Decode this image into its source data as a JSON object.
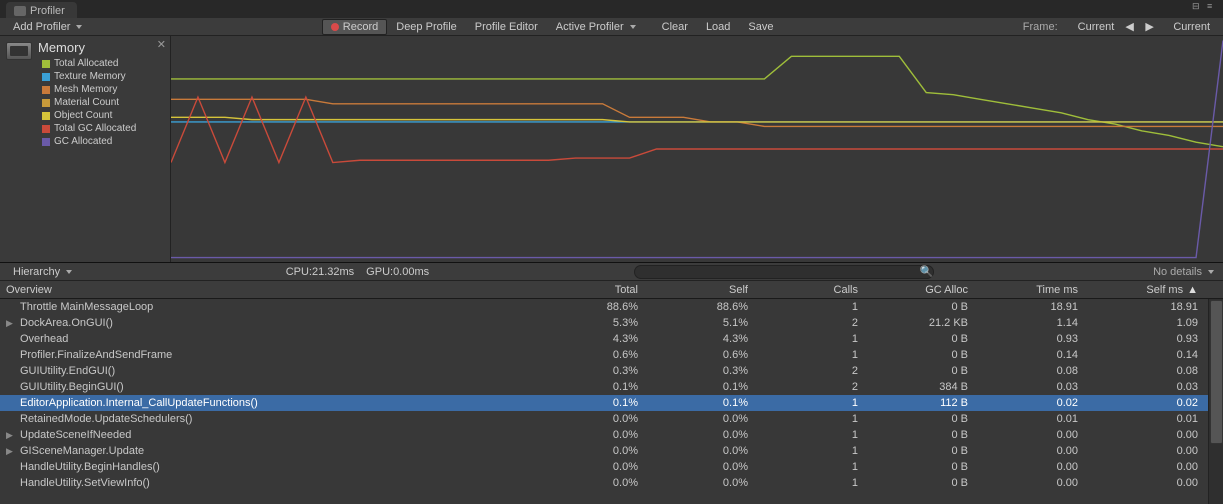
{
  "tab": {
    "title": "Profiler"
  },
  "toolbar": {
    "add_profiler": "Add Profiler",
    "record": "Record",
    "deep_profile": "Deep Profile",
    "profile_editor": "Profile Editor",
    "active_profiler": "Active Profiler",
    "clear": "Clear",
    "load": "Load",
    "save": "Save",
    "frame_label": "Frame:",
    "frame_value": "Current",
    "current_btn": "Current"
  },
  "legend": {
    "title": "Memory",
    "items": [
      {
        "label": "Total Allocated",
        "color": "#9fbe3a"
      },
      {
        "label": "Texture Memory",
        "color": "#3aa0d6"
      },
      {
        "label": "Mesh Memory",
        "color": "#c97a3a"
      },
      {
        "label": "Material Count",
        "color": "#c79a3a"
      },
      {
        "label": "Object Count",
        "color": "#d6c43a"
      },
      {
        "label": "Total GC Allocated",
        "color": "#c94a3a"
      },
      {
        "label": "GC Allocated",
        "color": "#6a5aa8"
      }
    ]
  },
  "stats": {
    "cpu": "CPU:21.32ms",
    "gpu": "GPU:0.00ms"
  },
  "lower": {
    "hierarchy": "Hierarchy",
    "no_details": "No details"
  },
  "columns": {
    "overview": "Overview",
    "total": "Total",
    "self": "Self",
    "calls": "Calls",
    "gc": "GC Alloc",
    "time": "Time ms",
    "selfms": "Self ms"
  },
  "rows": [
    {
      "name": "Throttle MainMessageLoop",
      "total": "88.6%",
      "self": "88.6%",
      "calls": "1",
      "gc": "0 B",
      "time": "18.91",
      "selfms": "18.91",
      "expandable": false
    },
    {
      "name": "DockArea.OnGUI()",
      "total": "5.3%",
      "self": "5.1%",
      "calls": "2",
      "gc": "21.2 KB",
      "time": "1.14",
      "selfms": "1.09",
      "expandable": true
    },
    {
      "name": "Overhead",
      "total": "4.3%",
      "self": "4.3%",
      "calls": "1",
      "gc": "0 B",
      "time": "0.93",
      "selfms": "0.93",
      "expandable": false
    },
    {
      "name": "Profiler.FinalizeAndSendFrame",
      "total": "0.6%",
      "self": "0.6%",
      "calls": "1",
      "gc": "0 B",
      "time": "0.14",
      "selfms": "0.14",
      "expandable": false
    },
    {
      "name": "GUIUtility.EndGUI()",
      "total": "0.3%",
      "self": "0.3%",
      "calls": "2",
      "gc": "0 B",
      "time": "0.08",
      "selfms": "0.08",
      "expandable": false
    },
    {
      "name": "GUIUtility.BeginGUI()",
      "total": "0.1%",
      "self": "0.1%",
      "calls": "2",
      "gc": "384 B",
      "time": "0.03",
      "selfms": "0.03",
      "expandable": false
    },
    {
      "name": "EditorApplication.Internal_CallUpdateFunctions()",
      "total": "0.1%",
      "self": "0.1%",
      "calls": "1",
      "gc": "112 B",
      "time": "0.02",
      "selfms": "0.02",
      "expandable": false,
      "selected": true
    },
    {
      "name": "RetainedMode.UpdateSchedulers()",
      "total": "0.0%",
      "self": "0.0%",
      "calls": "1",
      "gc": "0 B",
      "time": "0.01",
      "selfms": "0.01",
      "expandable": false
    },
    {
      "name": "UpdateSceneIfNeeded",
      "total": "0.0%",
      "self": "0.0%",
      "calls": "1",
      "gc": "0 B",
      "time": "0.00",
      "selfms": "0.00",
      "expandable": true
    },
    {
      "name": "GISceneManager.Update",
      "total": "0.0%",
      "self": "0.0%",
      "calls": "1",
      "gc": "0 B",
      "time": "0.00",
      "selfms": "0.00",
      "expandable": true
    },
    {
      "name": "HandleUtility.BeginHandles()",
      "total": "0.0%",
      "self": "0.0%",
      "calls": "1",
      "gc": "0 B",
      "time": "0.00",
      "selfms": "0.00",
      "expandable": false
    },
    {
      "name": "HandleUtility.SetViewInfo()",
      "total": "0.0%",
      "self": "0.0%",
      "calls": "1",
      "gc": "0 B",
      "time": "0.00",
      "selfms": "0.00",
      "expandable": false
    }
  ],
  "chart_data": {
    "type": "line",
    "title": "Memory",
    "xlabel": "",
    "ylabel": "",
    "series": [
      {
        "name": "Texture Memory",
        "color": "#3aa0d6",
        "values": [
          62,
          62,
          62,
          62,
          62,
          62,
          62,
          62,
          62,
          62,
          62,
          62,
          62,
          62,
          62,
          62,
          62,
          62,
          62,
          62,
          62,
          62,
          62,
          62,
          62,
          62,
          62,
          62,
          62,
          62,
          62,
          62,
          62,
          62,
          62,
          62,
          62,
          62,
          62,
          62
        ]
      },
      {
        "name": "Total Allocated",
        "color": "#9fbe3a",
        "values": [
          81,
          81,
          81,
          81,
          81,
          81,
          81,
          81,
          81,
          81,
          81,
          81,
          81,
          81,
          81,
          81,
          81,
          81,
          81,
          81,
          81,
          81,
          81,
          91,
          91,
          91,
          91,
          91,
          75,
          74,
          72,
          70,
          68,
          66,
          63,
          61,
          58,
          56,
          53,
          51
        ]
      },
      {
        "name": "Mesh Memory",
        "color": "#c97a3a",
        "values": [
          72,
          72,
          72,
          72,
          72,
          72,
          70,
          70,
          70,
          70,
          70,
          70,
          70,
          70,
          70,
          70,
          70,
          64,
          64,
          64,
          62,
          62,
          60,
          60,
          60,
          60,
          60,
          60,
          60,
          60,
          60,
          60,
          60,
          60,
          60,
          60,
          60,
          60,
          60,
          60
        ]
      },
      {
        "name": "Object Count",
        "color": "#d6c43a",
        "values": [
          64,
          64,
          64,
          63,
          63,
          63,
          63,
          63,
          63,
          63,
          63,
          63,
          63,
          63,
          63,
          63,
          63,
          62,
          62,
          62,
          62,
          62,
          62,
          62,
          62,
          62,
          62,
          62,
          62,
          62,
          62,
          62,
          62,
          62,
          62,
          62,
          62,
          62,
          62,
          62
        ]
      },
      {
        "name": "Total GC Allocated",
        "color": "#c94a3a",
        "values": [
          44,
          73,
          44,
          73,
          44,
          73,
          44,
          45,
          45,
          45,
          45,
          45,
          45,
          45,
          45,
          46,
          46,
          46,
          50,
          50,
          50,
          50,
          50,
          50,
          50,
          50,
          50,
          50,
          50,
          50,
          50,
          50,
          50,
          50,
          50,
          50,
          50,
          50,
          50,
          50
        ]
      },
      {
        "name": "GC Allocated",
        "color": "#6a5aa8",
        "values": [
          2,
          2,
          2,
          2,
          2,
          2,
          2,
          2,
          2,
          2,
          2,
          2,
          2,
          2,
          2,
          2,
          2,
          2,
          2,
          2,
          2,
          2,
          2,
          2,
          2,
          2,
          2,
          2,
          2,
          2,
          2,
          2,
          2,
          2,
          2,
          2,
          2,
          2,
          2,
          98
        ]
      }
    ],
    "xrange": [
      0,
      40
    ],
    "ylim": [
      0,
      100
    ]
  }
}
